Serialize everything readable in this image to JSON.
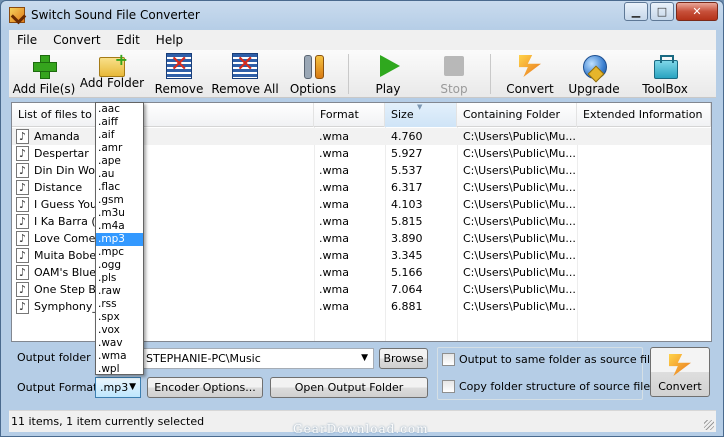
{
  "window": {
    "title": "Switch Sound File Converter"
  },
  "menu": [
    "File",
    "Convert",
    "Edit",
    "Help"
  ],
  "toolbar": {
    "add_files": "Add File(s)",
    "add_folder": "Add Folder",
    "remove": "Remove",
    "remove_all": "Remove All",
    "options": "Options",
    "play": "Play",
    "stop": "Stop",
    "convert": "Convert",
    "upgrade": "Upgrade",
    "toolbox": "ToolBox"
  },
  "list": {
    "columns": [
      "List of files to co",
      "Format",
      "Size",
      "Containing Folder",
      "Extended Information"
    ],
    "rows": [
      {
        "name": "Amanda",
        "format": ".wma",
        "size": "4.760",
        "folder": "C:\\Users\\Public\\Mu..."
      },
      {
        "name": "Despertar",
        "format": ".wma",
        "size": "5.927",
        "folder": "C:\\Users\\Public\\Mu..."
      },
      {
        "name": "Din Din Wo (",
        "format": ".wma",
        "size": "5.537",
        "folder": "C:\\Users\\Public\\Mu..."
      },
      {
        "name": "Distance",
        "format": ".wma",
        "size": "6.317",
        "folder": "C:\\Users\\Public\\Mu..."
      },
      {
        "name": "I Guess You'",
        "format": ".wma",
        "size": "4.103",
        "folder": "C:\\Users\\Public\\Mu..."
      },
      {
        "name": "I Ka Barra (Y",
        "format": ".wma",
        "size": "5.815",
        "folder": "C:\\Users\\Public\\Mu..."
      },
      {
        "name": "Love Comes",
        "format": ".wma",
        "size": "3.890",
        "folder": "C:\\Users\\Public\\Mu..."
      },
      {
        "name": "Muita Bobeira",
        "format": ".wma",
        "size": "3.345",
        "folder": "C:\\Users\\Public\\Mu..."
      },
      {
        "name": "OAM's Blues",
        "format": ".wma",
        "size": "5.166",
        "folder": "C:\\Users\\Public\\Mu..."
      },
      {
        "name": "One Step Be",
        "format": ".wma",
        "size": "7.064",
        "folder": "C:\\Users\\Public\\Mu..."
      },
      {
        "name": "Symphony_N",
        "format": ".wma",
        "size": "6.881",
        "folder": "C:\\Users\\Public\\Mu..."
      }
    ],
    "icon": "music-note-icon"
  },
  "format_dropdown": {
    "options": [
      ".aac",
      ".aiff",
      ".aif",
      ".amr",
      ".ape",
      ".au",
      ".flac",
      ".gsm",
      ".m3u",
      ".m4a",
      ".mp3",
      ".mpc",
      ".ogg",
      ".pls",
      ".raw",
      ".rss",
      ".spx",
      ".vox",
      ".wav",
      ".wma",
      ".wpl"
    ],
    "selected": ".mp3"
  },
  "bottom": {
    "output_folder_label": "Output folder",
    "output_folder_value": "STEPHANIE-PC\\Music",
    "browse": "Browse",
    "output_format_label": "Output Format",
    "output_format_value": ".mp3",
    "encoder_options": "Encoder Options...",
    "open_output_folder": "Open Output Folder",
    "same_folder": "Output to same folder as source files",
    "copy_structure": "Copy folder structure of source files",
    "convert": "Convert"
  },
  "status": {
    "text": "11 items, 1 item currently selected"
  },
  "watermark": "GearDownload.com"
}
